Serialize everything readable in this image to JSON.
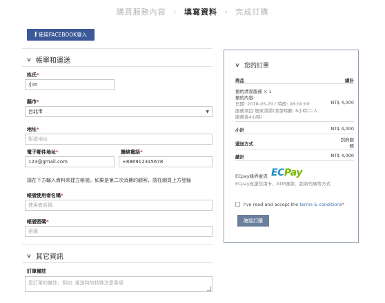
{
  "steps": {
    "step1": "購買服務內容",
    "step2": "填寫資料",
    "step3": "完成訂購",
    "separator": "›"
  },
  "facebook": {
    "icon_glyph": "f",
    "label": "使用FACEBOOK登入"
  },
  "billing": {
    "title": "帳單和運送",
    "name": {
      "label": "姓氏",
      "required": "*",
      "value": "小in"
    },
    "city": {
      "label": "縣市",
      "required": "*",
      "value": "台北市"
    },
    "address": {
      "label": "地址",
      "required": "*",
      "placeholder": "街道地址"
    },
    "email": {
      "label": "電子郵件地址",
      "required": "*",
      "value": "123@gmail.com"
    },
    "phone": {
      "label": "聯絡電話",
      "required": "*",
      "value": "+886912345678"
    },
    "account_note": "請在下方輸入資料來建立帳號。如果是第二次消費的顧客，請在網頁上方登錄",
    "username": {
      "label": "帳號使用者名稱",
      "required": "*",
      "placeholder": "使用者名稱"
    },
    "password": {
      "label": "帳號密碼",
      "required": "*",
      "placeholder": "密碼"
    }
  },
  "other": {
    "title": "其它資訊",
    "notes": {
      "label": "訂單備註",
      "placeholder": "您訂單的備註，例如: 運送時的特殊注意事項"
    }
  },
  "order": {
    "title": "您的訂單",
    "col_product": "商品",
    "col_total": "總計",
    "item": {
      "name": "預約清潔服務 × 1",
      "content_label": "預約內容:",
      "date": "日期: 2018-05-29 / 時間: 08:00:00",
      "service_line1": "服務項目:居家清掃(清潔時數: 8小時(二人",
      "service_line2": "服務各4小時)",
      "price": "NT$ 4,000"
    },
    "subtotal_label": "小計",
    "subtotal_value": "NT$ 4,000",
    "shipping_label": "運送方式",
    "shipping_value_line1": "到府服",
    "shipping_value_line2": "務",
    "total_label": "總計",
    "total_value": "NT$ 4,000",
    "ecpay_text": "ECpay綠界金流",
    "ecpay_logo_e": "EC",
    "ecpay_logo_pay": "Pay",
    "ecpay_desc": "ECpay支援信用卡、ATM匯款、超商代碼等方式",
    "terms_prefix": "I've read and accept the ",
    "terms_link": "terms & conditions",
    "terms_required": "*",
    "confirm_button": "確認訂購"
  },
  "colors": {
    "facebook": "#3b5998",
    "panel_border": "#8a9ab0",
    "confirm_button": "#6a7f9c",
    "required": "#c0392b",
    "link": "#3a6fb0"
  }
}
